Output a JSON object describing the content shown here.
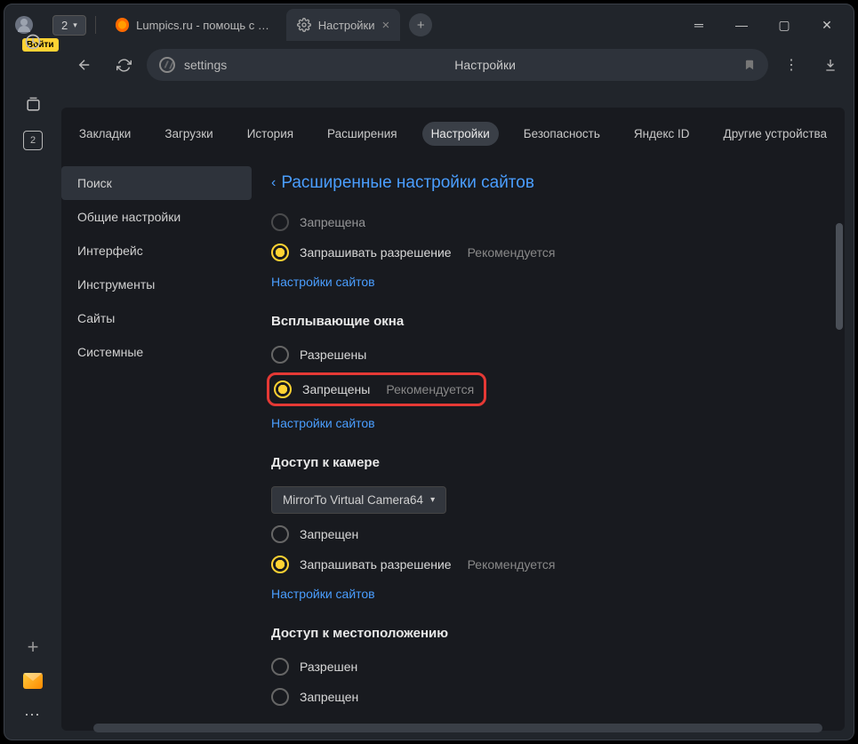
{
  "titlebar": {
    "login_label": "Войти",
    "tab_count": "2",
    "inactive_tab": "Lumpics.ru - помощь с ком",
    "active_tab": "Настройки"
  },
  "toolbar": {
    "address": "settings",
    "page_label": "Настройки"
  },
  "rail": {
    "badge": "2"
  },
  "topnav": {
    "items": [
      "Закладки",
      "Загрузки",
      "История",
      "Расширения",
      "Настройки",
      "Безопасность",
      "Яндекс ID",
      "Другие устройства"
    ],
    "active_index": 4
  },
  "leftnav": {
    "items": [
      "Поиск",
      "Общие настройки",
      "Интерфейс",
      "Инструменты",
      "Сайты",
      "Системные"
    ],
    "selected_index": 0
  },
  "page": {
    "title": "Расширенные настройки сайтов",
    "truncated_option": "Запрещена",
    "ask_permission": "Запрашивать разрешение",
    "recommended": "Рекомендуется",
    "site_settings_link": "Настройки сайтов",
    "popups": {
      "title": "Всплывающие окна",
      "allowed": "Разрешены",
      "blocked": "Запрещены"
    },
    "camera": {
      "title": "Доступ к камере",
      "device": "MirrorTo Virtual Camera64",
      "blocked": "Запрещен"
    },
    "location": {
      "title": "Доступ к местоположению",
      "allowed": "Разрешен",
      "blocked": "Запрещен"
    }
  }
}
